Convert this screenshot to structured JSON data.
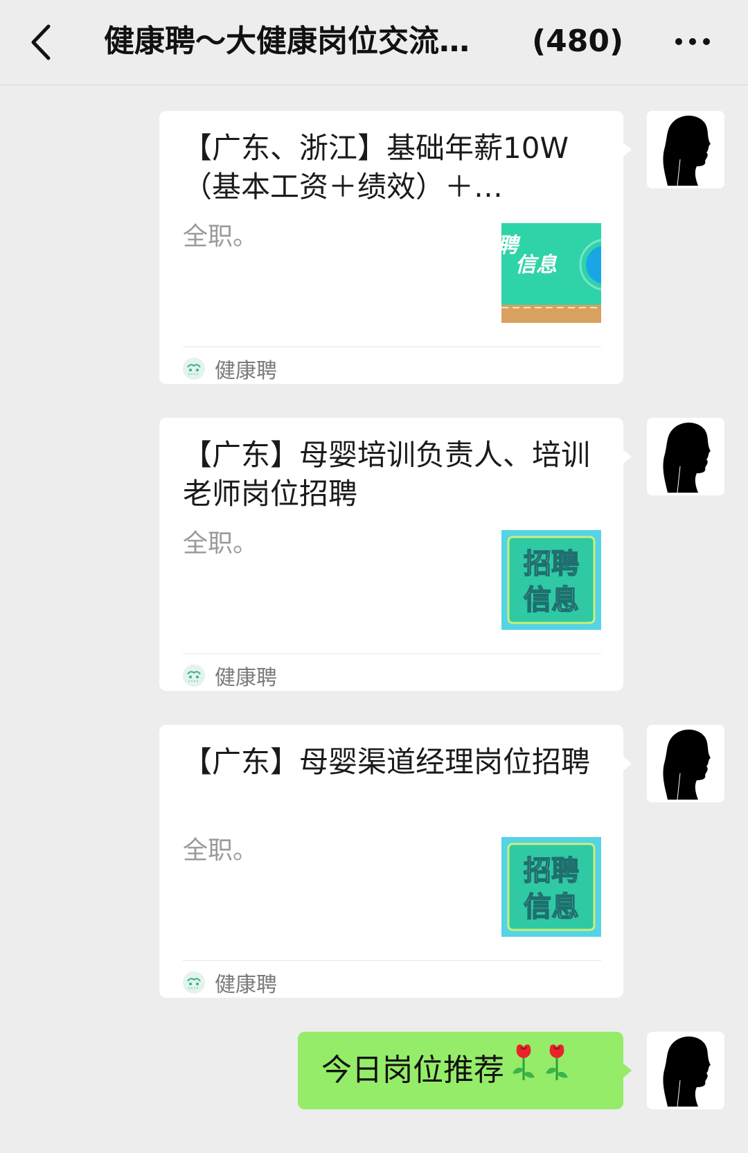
{
  "header": {
    "title": "健康聘～大健康岗位交流…",
    "member_count": "(480)"
  },
  "messages": [
    {
      "type": "link-card",
      "title": "【广东、浙江】基础年薪10W（基本工资＋绩效）＋…",
      "description": "全职。",
      "source": "健康聘",
      "thumb_text_line1": "聘",
      "thumb_text_line2": "信息"
    },
    {
      "type": "link-card",
      "title": "【广东】母婴培训负责人、培训老师岗位招聘",
      "description": "全职。",
      "source": "健康聘",
      "thumb_text_line1": "招聘",
      "thumb_text_line2": "信息"
    },
    {
      "type": "link-card",
      "title": "【广东】母婴渠道经理岗位招聘",
      "description": "全职。",
      "source": "健康聘",
      "thumb_text_line1": "招聘",
      "thumb_text_line2": "信息"
    },
    {
      "type": "text",
      "text": "今日岗位推荐",
      "emoji": "rose-emoji rose-emoji"
    }
  ],
  "colors": {
    "background": "#ededed",
    "self_bubble": "#95ec69",
    "card": "#ffffff",
    "thumb_teal": "#2fd3a8"
  },
  "icons": {
    "back": "chevron-left-icon",
    "more": "more-dots-icon",
    "source": "jiankangpin-logo-icon"
  }
}
